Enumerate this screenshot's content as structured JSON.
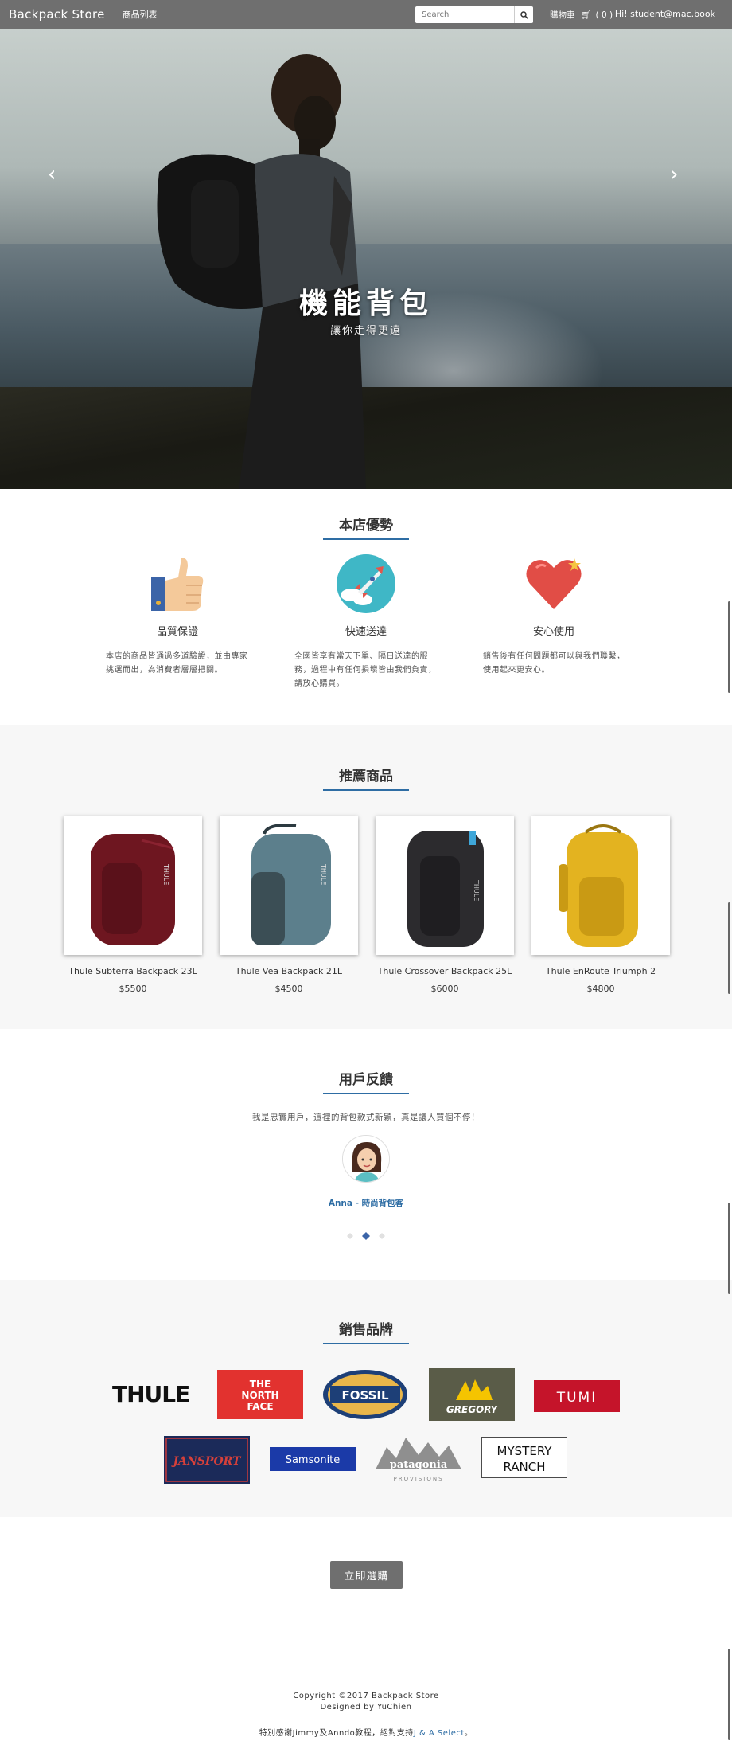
{
  "navbar": {
    "brand": "Backpack Store",
    "products_link": "商品列表",
    "search_placeholder": "Search",
    "cart_label": "購物車",
    "cart_count": "( 0 )",
    "user_greeting": "Hi! student@mac.book"
  },
  "hero": {
    "title": "機能背包",
    "subtitle": "讓你走得更遠"
  },
  "advantages": {
    "title": "本店優勢",
    "items": [
      {
        "icon": "thumbs-up-icon",
        "heading": "品質保證",
        "text": "本店的商品皆通過多道驗證，並由專家挑選而出，為消費者層層把關。"
      },
      {
        "icon": "rocket-icon",
        "heading": "快速送達",
        "text": "全國皆享有當天下單、隔日送達的服務，過程中有任何損壞皆由我們負責，請放心購買。"
      },
      {
        "icon": "heart-icon",
        "heading": "安心使用",
        "text": "銷售後有任何問題都可以與我們聯繫，使用起來更安心。"
      }
    ]
  },
  "products": {
    "title": "推薦商品",
    "items": [
      {
        "name": "Thule Subterra Backpack 23L",
        "price": "$5500",
        "color": "#6e1620"
      },
      {
        "name": "Thule Vea Backpack 21L",
        "price": "$4500",
        "color": "#5c7f8c"
      },
      {
        "name": "Thule Crossover Backpack 25L",
        "price": "$6000",
        "color": "#2c2b2e"
      },
      {
        "name": "Thule EnRoute Triumph 2",
        "price": "$4800",
        "color": "#e3b320"
      }
    ]
  },
  "testimonials": {
    "title": "用戶反饋",
    "quote": "我是忠實用戶，這裡的背包款式新穎，真是讓人買個不停！",
    "author": "Anna - 時尚背包客"
  },
  "brands": {
    "title": "銷售品牌",
    "row1": [
      "THULE",
      "THE NORTH FACE",
      "FOSSIL",
      "GREGORY",
      "TUMI"
    ],
    "row2": [
      "JANSPORT",
      "Samsonite",
      "patagonia",
      "MYSTERY RANCH"
    ]
  },
  "cta": {
    "label": "立即選購"
  },
  "footer": {
    "copyright": "Copyright ©2017 Backpack Store",
    "designer": "Designed by YuChien",
    "thanks_prefix": "特別感謝Jimmy及Anndo教程，絕對支持",
    "thanks_link": "J & A Select",
    "thanks_suffix": "。"
  },
  "colors": {
    "accent": "#2e6da4",
    "nav_bg": "#6f6f6f",
    "section_bg": "#f7f7f7"
  }
}
